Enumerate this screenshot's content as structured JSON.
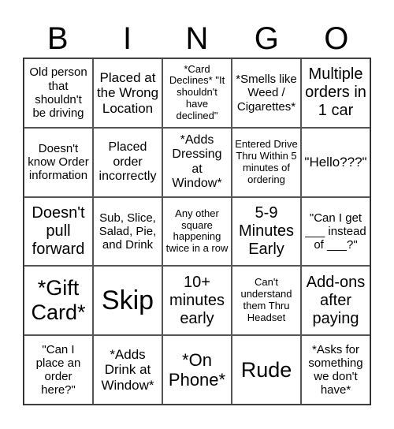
{
  "header": {
    "letters": [
      "B",
      "I",
      "N",
      "G",
      "O"
    ]
  },
  "cells": [
    "Old person that shouldn't be driving",
    "Placed at the Wrong Location",
    "*Card Declines* \"It shouldn't have declined\"",
    "*Smells like Weed / Cigarettes*",
    "Multiple orders in 1 car",
    "Doesn't know Order information",
    "Placed order incorrectly",
    "*Adds Dressing at Window*",
    "Entered Drive Thru Within 5 minutes of ordering",
    "\"Hello???\"",
    "Doesn't pull forward",
    "Sub, Slice, Salad, Pie, and Drink",
    "Any other square happening twice in a row",
    "5-9 Minutes Early",
    "\"Can I get ___ instead of ___?\"",
    "*Gift Card*",
    "Skip",
    "10+ minutes early",
    "Can't understand them Thru Headset",
    "Add-ons after paying",
    "\"Can I place an order here?\"",
    "*Adds Drink at Window*",
    "*On Phone*",
    "Rude",
    "*Asks for something we don't have*"
  ]
}
